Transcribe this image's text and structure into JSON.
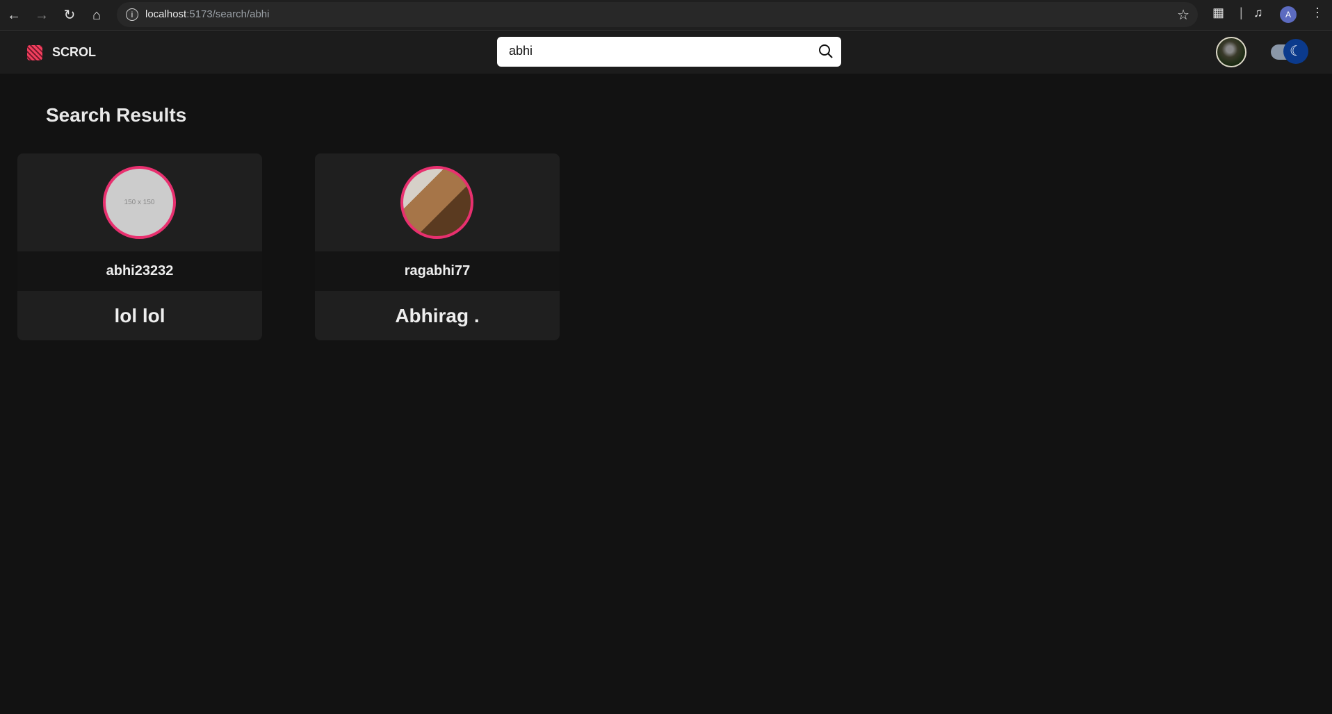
{
  "browser": {
    "url_host": "localhost",
    "url_path": ":5173/search/abhi",
    "profile_initial": "A"
  },
  "header": {
    "brand": "SCROL",
    "search_value": "abhi",
    "search_placeholder": "Search"
  },
  "main": {
    "title": "Search Results",
    "results": [
      {
        "username": "abhi23232",
        "name": "lol lol",
        "avatar_text": "150 x 150"
      },
      {
        "username": "ragabhi77",
        "name": "Abhirag ."
      }
    ]
  },
  "colors": {
    "accent": "#e8306f",
    "toggle_knob": "#0b3a8c"
  }
}
